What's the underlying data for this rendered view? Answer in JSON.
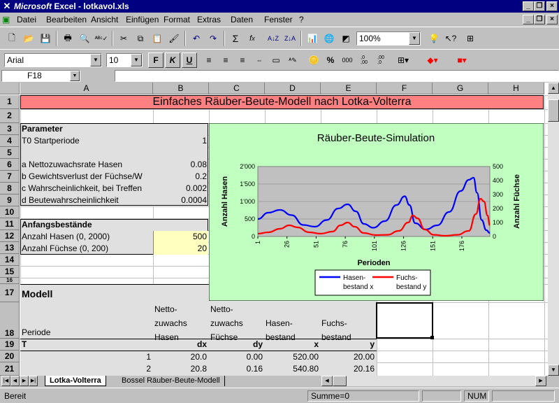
{
  "window": {
    "app_brand": "Microsoft",
    "title_rest": " Excel - lotkavol.xls"
  },
  "menu": [
    "Datei",
    "Bearbeiten",
    "Ansicht",
    "Einfügen",
    "Format",
    "Extras",
    "Daten",
    "Fenster",
    "?"
  ],
  "toolbar": {
    "zoom": "100%",
    "font": "Arial",
    "font_size": "10",
    "bold": "F",
    "italic": "K",
    "underline": "U",
    "percent": "%",
    "thousands": "000",
    "inc_dec": ",0\n,00",
    "dec_dec": ",00\n,0"
  },
  "formula_bar": {
    "cell_ref": "F18",
    "content": ""
  },
  "columns": [
    "A",
    "B",
    "C",
    "D",
    "E",
    "F",
    "G",
    "H"
  ],
  "rows": [
    "1",
    "2",
    "3",
    "4",
    "5",
    "6",
    "7",
    "8",
    "9",
    "10",
    "11",
    "12",
    "13",
    "14",
    "15",
    "16",
    "17",
    "18",
    "19",
    "20",
    "21"
  ],
  "sheet": {
    "title": "Einfaches Räuber-Beute-Modell nach Lotka-Volterra",
    "param_header": "Parameter",
    "t0_label": "T0 Startperiode",
    "t0_value": "1",
    "a_label": "a Nettozuwachsrate Hasen",
    "a_value": "0.08",
    "b_label": "b Gewichtsverlust der Füchse/W",
    "b_value": "0.2",
    "c_label": "c Wahrscheinlichkeit, bei Treffen",
    "c_value": "0.002",
    "d_label": "d Beutewahrscheinlichkeit",
    "d_value": "0.0004",
    "init_header": "Anfangsbestände",
    "hasen_label": "Anzahl Hasen (0, 2000)",
    "hasen_value": "500",
    "fuechse_label": "Anzahl Füchse (0, 200)",
    "fuechse_value": "20",
    "model_header": "Modell",
    "periode": "Periode",
    "col_b_header": "Netto-\nzuwachs\nHasen",
    "col_c_header": "Netto-\nzuwachs\nFüchse",
    "col_d_header": "Hasen-\nbestand",
    "col_e_header": "Fuchs-\nbestand",
    "r19": [
      "T",
      "dx",
      "dy",
      "x",
      "y"
    ],
    "r20": [
      "1",
      "20.0",
      "0.00",
      "520.00",
      "20.00"
    ],
    "r21": [
      "2",
      "20.8",
      "0.16",
      "540.80",
      "20.16"
    ]
  },
  "chart_data": {
    "type": "line",
    "title": "Räuber-Beute-Simulation",
    "xlabel": "Perioden",
    "ylabel": "Anzahl Hasen",
    "ylabel2": "Anzahl Füchse",
    "x_ticks": [
      "1",
      "26",
      "51",
      "76",
      "101",
      "126",
      "151",
      "176"
    ],
    "y_ticks": [
      "0",
      "500",
      "1'000",
      "1'500",
      "2'000"
    ],
    "y2_ticks": [
      "0",
      "100",
      "200",
      "300",
      "400",
      "500"
    ],
    "xlim": [
      1,
      200
    ],
    "ylim": [
      0,
      2000
    ],
    "y2lim": [
      0,
      500
    ],
    "series": [
      {
        "name": "Hasen-\nbestand x",
        "axis": "left",
        "color": "#0000ff",
        "points": [
          [
            1,
            500
          ],
          [
            10,
            680
          ],
          [
            20,
            760
          ],
          [
            30,
            610
          ],
          [
            40,
            330
          ],
          [
            50,
            280
          ],
          [
            60,
            470
          ],
          [
            70,
            800
          ],
          [
            78,
            920
          ],
          [
            85,
            720
          ],
          [
            92,
            360
          ],
          [
            100,
            250
          ],
          [
            110,
            440
          ],
          [
            120,
            900
          ],
          [
            127,
            1150
          ],
          [
            131,
            900
          ],
          [
            136,
            380
          ],
          [
            145,
            200
          ],
          [
            155,
            320
          ],
          [
            165,
            700
          ],
          [
            175,
            1300
          ],
          [
            182,
            1620
          ],
          [
            186,
            1680
          ],
          [
            189,
            1250
          ],
          [
            193,
            470
          ],
          [
            197,
            180
          ],
          [
            200,
            100
          ]
        ]
      },
      {
        "name": "Fuchs-\nbestand y",
        "axis": "right",
        "color": "#ff0000",
        "points": [
          [
            1,
            20
          ],
          [
            10,
            30
          ],
          [
            20,
            55
          ],
          [
            28,
            80
          ],
          [
            35,
            65
          ],
          [
            45,
            30
          ],
          [
            55,
            20
          ],
          [
            65,
            35
          ],
          [
            72,
            80
          ],
          [
            78,
            100
          ],
          [
            84,
            70
          ],
          [
            92,
            25
          ],
          [
            102,
            10
          ],
          [
            112,
            12
          ],
          [
            122,
            40
          ],
          [
            130,
            100
          ],
          [
            134,
            150
          ],
          [
            138,
            130
          ],
          [
            144,
            50
          ],
          [
            152,
            12
          ],
          [
            162,
            5
          ],
          [
            172,
            12
          ],
          [
            182,
            40
          ],
          [
            188,
            160
          ],
          [
            192,
            270
          ],
          [
            195,
            250
          ],
          [
            198,
            150
          ],
          [
            200,
            80
          ]
        ]
      }
    ]
  },
  "tabs": [
    "Lotka-Volterra",
    "Bossel Räuber-Beute-Modell"
  ],
  "status": {
    "left": "Bereit",
    "sum": "Summe=0",
    "num": "NUM"
  },
  "colors": {
    "title_bg": "#ff8080",
    "input_bg": "#ffffc0",
    "chart_bg": "#c0ffc0"
  }
}
